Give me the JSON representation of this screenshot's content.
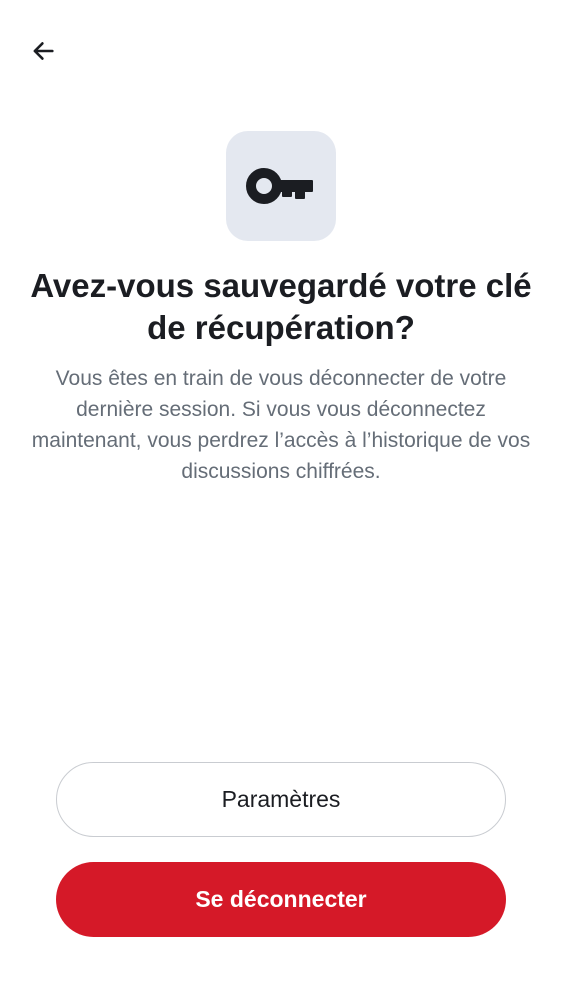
{
  "header": {
    "back_icon": "arrow-left-icon"
  },
  "hero": {
    "icon": "key-icon",
    "tile_color": "#e4e8f0"
  },
  "title": "Avez-vous sauvegardé votre clé de récupération?",
  "description": "Vous êtes en train de vous déconnecter de votre dernière session. Si vous vous déconnectez maintenant, vous perdrez l’accès à l’historique de vos discussions chiffrées.",
  "buttons": {
    "settings_label": "Paramètres",
    "logout_label": "Se déconnecter",
    "logout_color": "#d51928"
  }
}
